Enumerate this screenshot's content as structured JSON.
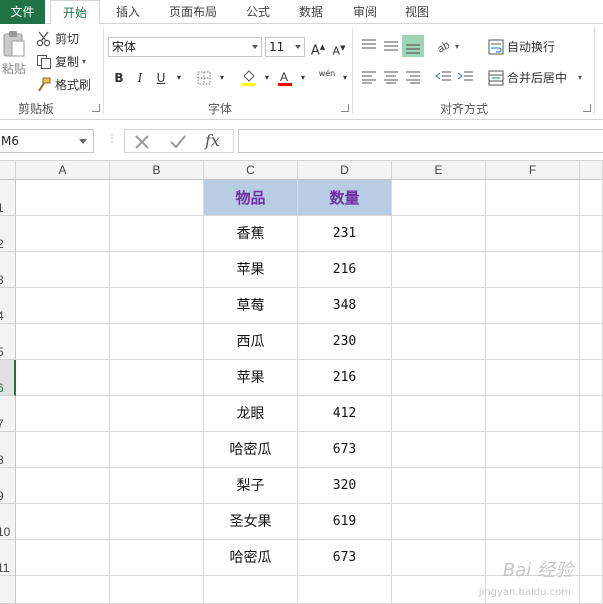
{
  "ribbon_tabs": [
    {
      "label": "文件"
    },
    {
      "label": "开始"
    },
    {
      "label": "插入"
    },
    {
      "label": "页面布局"
    },
    {
      "label": "公式"
    },
    {
      "label": "数据"
    },
    {
      "label": "审阅"
    },
    {
      "label": "视图"
    }
  ],
  "clipboard": {
    "paste": "粘贴",
    "cut": "剪切",
    "copy": "复制",
    "format_painter": "格式刷",
    "group": "剪贴板"
  },
  "font": {
    "name": "宋体",
    "size": "11",
    "bold": "B",
    "italic": "I",
    "underline": "U",
    "phonetic": "wén",
    "group": "字体",
    "fill_color": "#ffff00",
    "font_color": "#ff0000"
  },
  "alignment": {
    "wrap_text": "自动换行",
    "merge_center": "合并后居中",
    "group": "对齐方式"
  },
  "formula_bar": {
    "name_box": "M6",
    "fx": "fx",
    "formula": ""
  },
  "columns": [
    "A",
    "B",
    "C",
    "D",
    "E",
    "F"
  ],
  "rows": [
    "1",
    "2",
    "3",
    "4",
    "5",
    "6",
    "7",
    "8",
    "9",
    "10",
    "11"
  ],
  "selected_row": "6",
  "table": {
    "headers": [
      "物品",
      "数量"
    ],
    "header_fill": "#b8cce4",
    "header_text_color": "#7030a0",
    "data": [
      {
        "item": "香蕉",
        "qty": "231"
      },
      {
        "item": "苹果",
        "qty": "216"
      },
      {
        "item": "草莓",
        "qty": "348"
      },
      {
        "item": "西瓜",
        "qty": "230"
      },
      {
        "item": "苹果",
        "qty": "216"
      },
      {
        "item": "龙眼",
        "qty": "412"
      },
      {
        "item": "哈密瓜",
        "qty": "673"
      },
      {
        "item": "梨子",
        "qty": "320"
      },
      {
        "item": "圣女果",
        "qty": "619"
      },
      {
        "item": "哈密瓜",
        "qty": "673"
      }
    ]
  },
  "accent_color": "#217346",
  "watermark": {
    "main": "Bai 经验",
    "sub": "jingyan.baidu.com"
  }
}
